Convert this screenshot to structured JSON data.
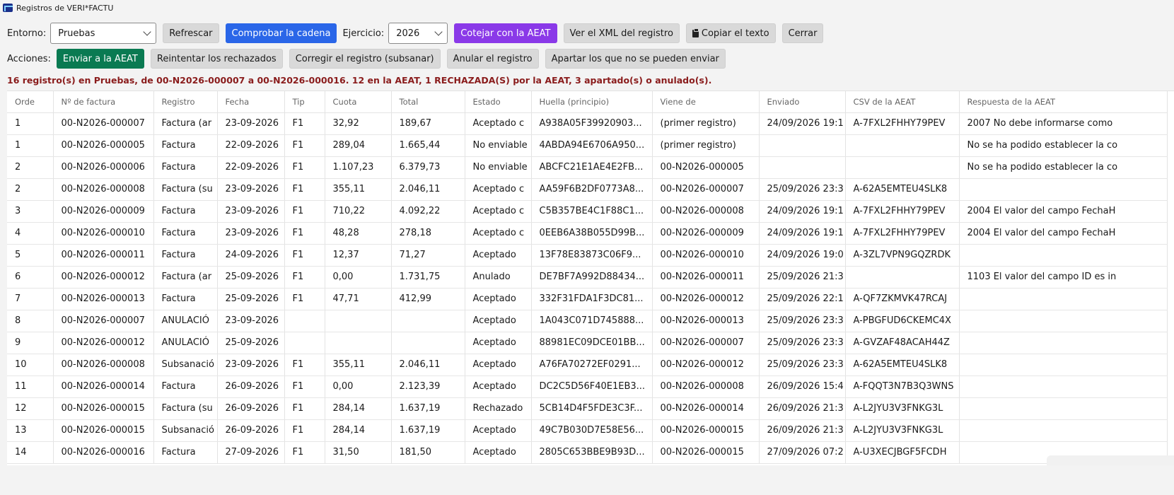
{
  "window": {
    "title": "Registros de VERI*FACTU"
  },
  "toolbar": {
    "entorno_label": "Entorno:",
    "entorno_value": "Pruebas",
    "refresh": "Refrescar",
    "check_chain": "Comprobar la cadena",
    "ejercicio_label": "Ejercicio:",
    "ejercicio_value": "2026",
    "compare": "Cotejar con la AEAT",
    "view_xml": "Ver el XML del registro",
    "copy_text": "Copiar el texto",
    "close": "Cerrar"
  },
  "actions": {
    "label": "Acciones:",
    "send": "Enviar a la AEAT",
    "retry": "Reintentar los rechazados",
    "fix": "Corregir el registro (subsanar)",
    "cancel": "Anular el registro",
    "set_aside": "Apartar los que no se pueden enviar"
  },
  "status_text": "16 registro(s) en Pruebas, de 00-N2026-000007 a 00-N2026-000016. 12 en la AEAT, 1 RECHAZADA(S) por la AEAT, 3 apartado(s) o anulado(s).",
  "colors": {
    "blue": "#2a66e8",
    "purple": "#8a39e8",
    "green": "#0a7a52",
    "status": "#8a1c1c"
  },
  "table": {
    "columns": [
      "Orde",
      "Nº de factura",
      "Registro",
      "Fecha",
      "Tip",
      "Cuota",
      "Total",
      "Estado",
      "Huella (principio)",
      "Viene de",
      "Enviado",
      "CSV de la AEAT",
      "Respuesta de la AEAT"
    ],
    "rows": [
      [
        "1",
        "00-N2026-000007",
        "Factura (ar",
        "23-09-2026",
        "F1",
        "32,92",
        "189,67",
        "Aceptado c",
        "A938A05F39920903...",
        "(primer registro)",
        "24/09/2026 19:1",
        "A-7FXL2FHHY79PEV",
        "2007 No debe informarse como"
      ],
      [
        "1",
        "00-N2026-000005",
        "Factura",
        "22-09-2026",
        "F1",
        "289,04",
        "1.665,44",
        "No enviable",
        "4ABDA94E6706A950...",
        "(primer registro)",
        "",
        "",
        "No se ha podido establecer la co"
      ],
      [
        "2",
        "00-N2026-000006",
        "Factura",
        "22-09-2026",
        "F1",
        "1.107,23",
        "6.379,73",
        "No enviable",
        "ABCFC21E1AE4E2FB...",
        "00-N2026-000005",
        "",
        "",
        "No se ha podido establecer la co"
      ],
      [
        "2",
        "00-N2026-000008",
        "Factura (su",
        "23-09-2026",
        "F1",
        "355,11",
        "2.046,11",
        "Aceptado c",
        "AA59F6B2DF0773A8...",
        "00-N2026-000007",
        "25/09/2026 23:3",
        "A-62A5EMTEU4SLK8",
        ""
      ],
      [
        "3",
        "00-N2026-000009",
        "Factura",
        "23-09-2026",
        "F1",
        "710,22",
        "4.092,22",
        "Aceptado c",
        "C5B357BE4C1F88C1...",
        "00-N2026-000008",
        "24/09/2026 19:1",
        "A-7FXL2FHHY79PEV",
        "2004 El valor del campo FechaH"
      ],
      [
        "4",
        "00-N2026-000010",
        "Factura",
        "23-09-2026",
        "F1",
        "48,28",
        "278,18",
        "Aceptado c",
        "0EEB6A38B055D99B...",
        "00-N2026-000009",
        "24/09/2026 19:1",
        "A-7FXL2FHHY79PEV",
        "2004 El valor del campo FechaH"
      ],
      [
        "5",
        "00-N2026-000011",
        "Factura",
        "24-09-2026",
        "F1",
        "12,37",
        "71,27",
        "Aceptado",
        "13F78E83873C06F9...",
        "00-N2026-000010",
        "24/09/2026 19:0",
        "A-3ZL7VPN9GQZRDK",
        ""
      ],
      [
        "6",
        "00-N2026-000012",
        "Factura (ar",
        "25-09-2026",
        "F1",
        "0,00",
        "1.731,75",
        "Anulado",
        "DE7BF7A992D88434...",
        "00-N2026-000011",
        "25/09/2026 21:3",
        "",
        "1103 El valor del campo ID es in"
      ],
      [
        "7",
        "00-N2026-000013",
        "Factura",
        "25-09-2026",
        "F1",
        "47,71",
        "412,99",
        "Aceptado",
        "332F31FDA1F3DC81...",
        "00-N2026-000012",
        "25/09/2026 22:1",
        "A-QF7ZKMVK47RCAJ",
        ""
      ],
      [
        "8",
        "00-N2026-000007",
        "ANULACIÓ",
        "23-09-2026",
        "",
        "",
        "",
        "Aceptado",
        "1A043C071D745888...",
        "00-N2026-000013",
        "25/09/2026 23:3",
        "A-PBGFUD6CKEMC4X",
        ""
      ],
      [
        "9",
        "00-N2026-000012",
        "ANULACIÓ",
        "25-09-2026",
        "",
        "",
        "",
        "Aceptado",
        "88981EC09DCE01BB...",
        "00-N2026-000007",
        "25/09/2026 23:3",
        "A-GVZAF48ACAH44Z",
        ""
      ],
      [
        "10",
        "00-N2026-000008",
        "Subsanació",
        "23-09-2026",
        "F1",
        "355,11",
        "2.046,11",
        "Aceptado",
        "A76FA70272EF0291...",
        "00-N2026-000012",
        "25/09/2026 23:3",
        "A-62A5EMTEU4SLK8",
        ""
      ],
      [
        "11",
        "00-N2026-000014",
        "Factura",
        "26-09-2026",
        "F1",
        "0,00",
        "2.123,39",
        "Aceptado",
        "DC2C5D56F40E1EB3...",
        "00-N2026-000008",
        "26/09/2026 15:4",
        "A-FQQT3N7B3Q3WNS",
        ""
      ],
      [
        "12",
        "00-N2026-000015",
        "Factura (su",
        "26-09-2026",
        "F1",
        "284,14",
        "1.637,19",
        "Rechazado",
        "5CB14D4F5FDE3C3F...",
        "00-N2026-000014",
        "26/09/2026 21:3",
        "A-L2JYU3V3FNKG3L",
        ""
      ],
      [
        "13",
        "00-N2026-000015",
        "Subsanació",
        "26-09-2026",
        "F1",
        "284,14",
        "1.637,19",
        "Aceptado",
        "49C7B030D7E58E56...",
        "00-N2026-000015",
        "26/09/2026 21:3",
        "A-L2JYU3V3FNKG3L",
        ""
      ],
      [
        "14",
        "00-N2026-000016",
        "Factura",
        "27-09-2026",
        "F1",
        "31,50",
        "181,50",
        "Aceptado",
        "2805C653BBE9B93D...",
        "00-N2026-000015",
        "27/09/2026 07:2",
        "A-U3XECJBGF5FCDH",
        ""
      ]
    ]
  }
}
